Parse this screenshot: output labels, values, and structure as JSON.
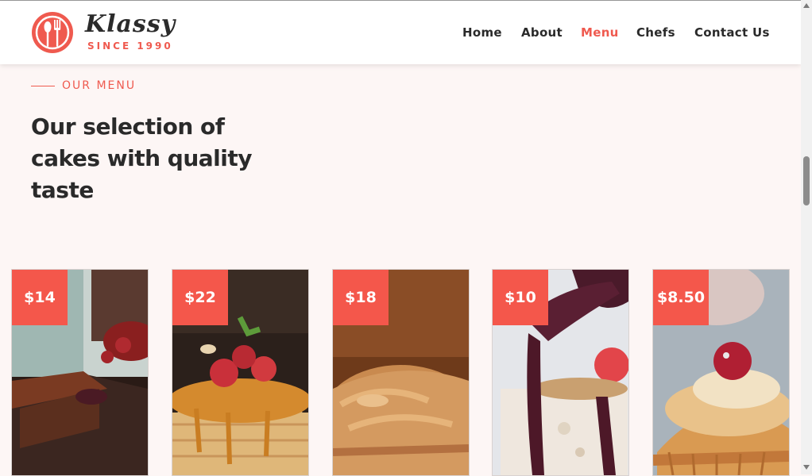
{
  "brand": {
    "name": "Klassy",
    "tagline": "SINCE 1990",
    "accent_color": "#ef5a4f"
  },
  "nav": {
    "items": [
      {
        "label": "Home",
        "active": false
      },
      {
        "label": "About",
        "active": false
      },
      {
        "label": "Menu",
        "active": true
      },
      {
        "label": "Chefs",
        "active": false
      },
      {
        "label": "Contact Us",
        "active": false
      }
    ]
  },
  "menu_section": {
    "label": "OUR MENU",
    "title": "Our selection of cakes with quality taste"
  },
  "cards": [
    {
      "price": "$14"
    },
    {
      "price": "$22"
    },
    {
      "price": "$18"
    },
    {
      "price": "$10"
    },
    {
      "price": "$8.50"
    }
  ],
  "icons": [
    "logo-spoon-fork-icon",
    "scroll-up-arrow-icon",
    "scroll-down-arrow-icon"
  ]
}
